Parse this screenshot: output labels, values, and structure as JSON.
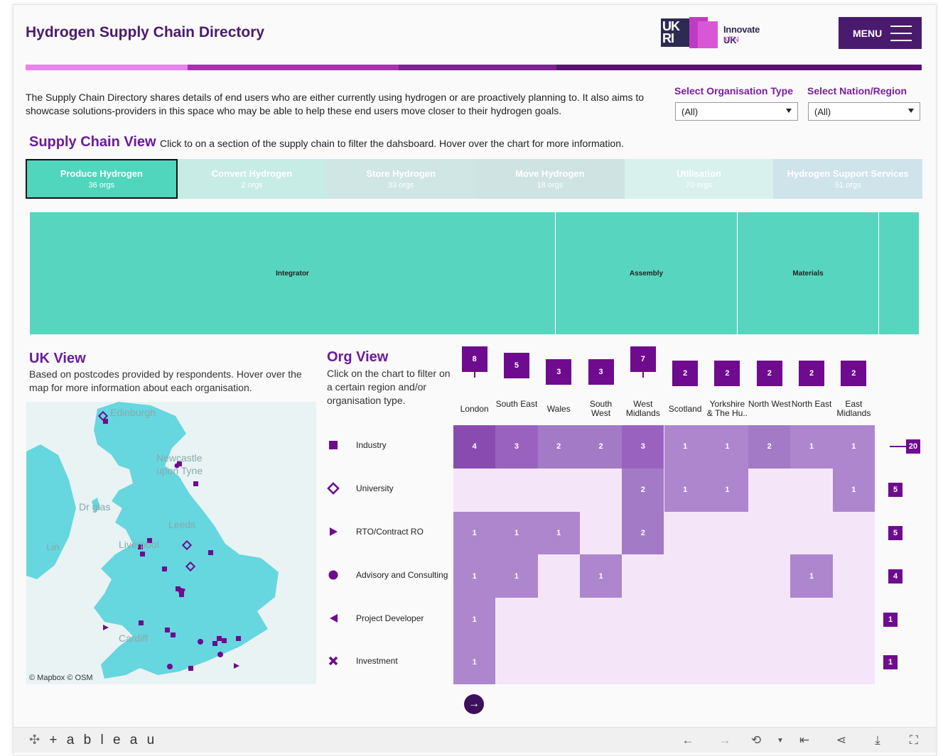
{
  "header": {
    "title": "Hydrogen Supply Chain Directory",
    "logo_ukri": "UK RI",
    "logo_line1": "Innovate UK",
    "logo_line2": "KTN",
    "menu_label": "MENU"
  },
  "stripe_colors": [
    "#f07ef0",
    "#b12bbd",
    "#8a1aa1",
    "#5a0f75"
  ],
  "intro_text": "The Supply Chain Directory shares details of end users who are either currently using hydrogen or are proactively planning to. It also aims to showcase solutions-providers in this space who may be able to help these end users move closer to their hydrogen goals.",
  "filters": {
    "org_type": {
      "label": "Select Organisation Type",
      "value": "(All)"
    },
    "nation": {
      "label": "Select Nation/Region",
      "value": "(All)"
    }
  },
  "supply_chain": {
    "title": "Supply Chain View",
    "help": "Click to on a section of the supply chain to filter the dahsboard. Hover over the chart for more information.",
    "tabs": [
      {
        "label": "Produce Hydrogen",
        "sub": "36 orgs",
        "color": "#4fd6bd",
        "active": true
      },
      {
        "label": "Convert Hydrogen",
        "sub": "2 orgs",
        "color": "#c7ece6"
      },
      {
        "label": "Store Hydrogen",
        "sub": "33 orgs",
        "color": "#cfe6e4"
      },
      {
        "label": "Move Hydrogen",
        "sub": "18 orgs",
        "color": "#cfe3e3"
      },
      {
        "label": "Utilisation",
        "sub": "70 orgs",
        "color": "#d8f1ec"
      },
      {
        "label": "Hydrogen Support Services",
        "sub": "51 orgs",
        "color": "#cfe3ea"
      }
    ],
    "treemap": [
      "Integrator",
      "Assembly",
      "Materials",
      ""
    ]
  },
  "uk_view": {
    "title": "UK View",
    "text": "Based on postcodes provided by respondents. Hover over the map for more information about each organisation.",
    "credit": "© Mapbox  © OSM",
    "places": [
      "Edinburgh",
      "Newcastle",
      "upon Tyne",
      "Dr  glas",
      "Leeds",
      "Liverpool",
      "Cardiff",
      "Lin"
    ]
  },
  "org_view": {
    "title": "Org View",
    "text": "Click on the chart to filter on a certain region and/or organisation type.",
    "regions": [
      {
        "label": "London",
        "total": "8"
      },
      {
        "label": "South East",
        "total": "5"
      },
      {
        "label": "Wales",
        "total": "3"
      },
      {
        "label": "South West",
        "total": "3"
      },
      {
        "label": "West Midlands",
        "total": "7"
      },
      {
        "label": "Scotland",
        "total": "2"
      },
      {
        "label": "Yorkshire & The Hu..",
        "total": "2"
      },
      {
        "label": "North West",
        "total": "2"
      },
      {
        "label": "North East",
        "total": "2"
      },
      {
        "label": "East Midlands",
        "total": "2"
      }
    ],
    "org_types": [
      {
        "label": "Industry",
        "icon": "square-icon",
        "total": "20"
      },
      {
        "label": "University",
        "icon": "diamond-icon",
        "total": "5"
      },
      {
        "label": "RTO/Contract RO",
        "icon": "triangle-right-icon",
        "total": "5"
      },
      {
        "label": "Advisory and Consulting",
        "icon": "circle-icon",
        "total": "4"
      },
      {
        "label": "Project Developer",
        "icon": "triangle-left-icon",
        "total": "1"
      },
      {
        "label": "Investment",
        "icon": "x-icon",
        "total": "1"
      }
    ],
    "matrix": [
      [
        "4",
        "3",
        "2",
        "2",
        "3",
        "1",
        "1",
        "2",
        "1",
        "1"
      ],
      [
        "",
        "",
        "",
        "",
        "2",
        "1",
        "1",
        "",
        "",
        "1"
      ],
      [
        "1",
        "1",
        "1",
        "",
        "2",
        "",
        "",
        "",
        "",
        ""
      ],
      [
        "1",
        "1",
        "",
        "1",
        "",
        "",
        "",
        "",
        "1",
        ""
      ],
      [
        "1",
        "",
        "",
        "",
        "",
        "",
        "",
        "",
        "",
        ""
      ],
      [
        "1",
        "",
        "",
        "",
        "",
        "",
        "",
        "",
        "",
        ""
      ]
    ]
  },
  "footer": {
    "brand": "+ a b l e a u",
    "icons": [
      "undo-icon",
      "redo-icon",
      "revert-icon",
      "reset-icon",
      "share-icon",
      "download-icon",
      "fullscreen-icon"
    ]
  }
}
